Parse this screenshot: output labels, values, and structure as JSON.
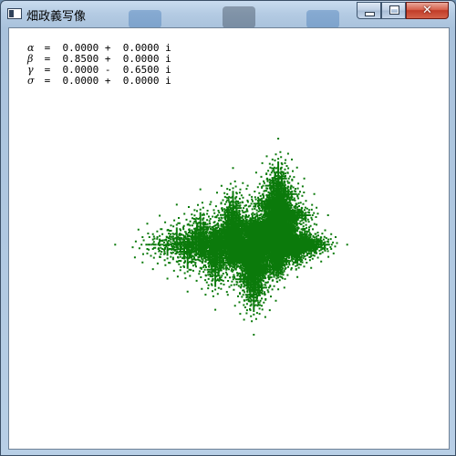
{
  "window": {
    "title": "畑政義写像",
    "buttons": {
      "minimize_icon": "minimize-icon",
      "maximize_icon": "maximize-icon",
      "close_icon": "close-icon",
      "close_glyph": "✕"
    }
  },
  "parameters": [
    {
      "symbol": "α",
      "text": " =  0.0000 +  0.0000 i"
    },
    {
      "symbol": "β",
      "text": " =  0.8500 +  0.0000 i"
    },
    {
      "symbol": "γ",
      "text": " =  0.0000 -  0.6500 i"
    },
    {
      "symbol": "σ",
      "text": " =  0.0000 +  0.0000 i"
    }
  ],
  "colors": {
    "fractal": "#0b7a0b",
    "canvas": "#ffffff"
  }
}
